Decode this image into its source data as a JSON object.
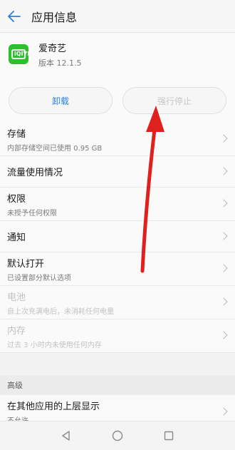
{
  "header": {
    "title": "应用信息"
  },
  "app": {
    "name": "爱奇艺",
    "version": "版本 12.1.5",
    "icon_text": "iQIYI",
    "icon_color": "#2bc12b"
  },
  "actions": {
    "uninstall": "卸载",
    "force_stop": "强行停止"
  },
  "rows": [
    {
      "title": "存储",
      "subtitle": "内部存储空间已使用 0.95 GB"
    },
    {
      "title": "流量使用情况"
    },
    {
      "title": "权限",
      "subtitle": "未授予任何权限"
    },
    {
      "title": "通知"
    },
    {
      "title": "默认打开",
      "subtitle": "已设置部分默认选项"
    },
    {
      "title": "电池",
      "subtitle": "自上次充满电后，未消耗任何电量"
    },
    {
      "title": "内存",
      "subtitle": "过去 3 小时内未使用任何内存"
    }
  ],
  "section": {
    "title": "高级"
  },
  "last_row": {
    "title": "在其他应用的上层显示",
    "subtitle": "不允许"
  },
  "colors": {
    "accent": "#2a7fe0",
    "annotation_arrow": "#e0201c"
  }
}
